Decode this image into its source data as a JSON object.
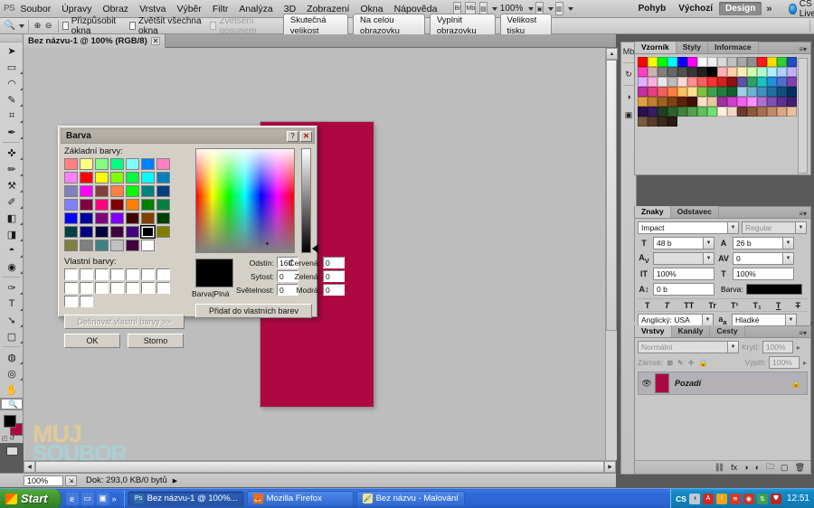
{
  "app": {
    "name": "Adobe Photoshop CS5",
    "logo": "PS"
  },
  "menubar": {
    "items": [
      "Soubor",
      "Úpravy",
      "Obraz",
      "Vrstva",
      "Výběr",
      "Filtr",
      "Analýza",
      "3D",
      "Zobrazení",
      "Okna",
      "Nápověda"
    ],
    "bridge_icon": "br-icon",
    "minibridge_icon": "mb-icon",
    "arrange_icon": "arrange-documents-icon",
    "zoom_level": "100%",
    "screen_mode_icon": "screen-mode-icon",
    "view_extras_icon": "view-extras-icon",
    "workspaces": [
      "Pohyb",
      "Výchozí",
      "Design"
    ],
    "active_workspace": "Design",
    "more_workspaces": "»",
    "cs_live": "CS Live",
    "window_buttons": [
      "minimize",
      "restore",
      "close"
    ]
  },
  "optionsbar": {
    "tool_icon": "zoom-tool-icon",
    "zoom_in_icon": "zoom-in-icon",
    "zoom_out_icon": "zoom-out-icon",
    "checkboxes": [
      {
        "label": "Přizpůsobit okna",
        "checked": false,
        "disabled": false
      },
      {
        "label": "Zvětšit všechna okna",
        "checked": false,
        "disabled": false
      },
      {
        "label": "Zvětšení posunem",
        "checked": false,
        "disabled": true
      }
    ],
    "buttons": [
      "Skutečná velikost",
      "Na celou obrazovku",
      "Vyplnit obrazovku",
      "Velikost tisku"
    ]
  },
  "toolbar": {
    "tools": [
      {
        "name": "move-tool",
        "glyph": "➤"
      },
      {
        "name": "marquee-tool",
        "glyph": "▭"
      },
      {
        "name": "lasso-tool",
        "glyph": "◠"
      },
      {
        "name": "quick-selection-tool",
        "glyph": "✎"
      },
      {
        "name": "crop-tool",
        "glyph": "⌗"
      },
      {
        "name": "eyedropper-tool",
        "glyph": "✒"
      },
      {
        "name": "spot-healing-brush-tool",
        "glyph": "✜"
      },
      {
        "name": "brush-tool",
        "glyph": "✏"
      },
      {
        "name": "clone-stamp-tool",
        "glyph": "⚑"
      },
      {
        "name": "history-brush-tool",
        "glyph": "✐"
      },
      {
        "name": "eraser-tool",
        "glyph": "◧"
      },
      {
        "name": "gradient-tool",
        "glyph": "◨"
      },
      {
        "name": "blur-tool",
        "glyph": "💧"
      },
      {
        "name": "dodge-tool",
        "glyph": "🔍"
      },
      {
        "name": "pen-tool",
        "glyph": "✑"
      },
      {
        "name": "type-tool",
        "glyph": "T"
      },
      {
        "name": "path-selection-tool",
        "glyph": "➘"
      },
      {
        "name": "rectangle-tool",
        "glyph": "▢"
      },
      {
        "name": "3d-rotate-tool",
        "glyph": "◍"
      },
      {
        "name": "3d-orbit-tool",
        "glyph": "◉"
      },
      {
        "name": "hand-tool",
        "glyph": "✋"
      },
      {
        "name": "zoom-tool",
        "glyph": "🔍",
        "selected": true
      }
    ],
    "foreground_color": "#000000",
    "background_color": "#ae0842",
    "quick_mask_icon": "quick-mask-icon"
  },
  "document": {
    "tab_title": "Bez názvu-1 @ 100% (RGB/8)",
    "close_icon": "close-icon",
    "canvas_color": "#ae0842"
  },
  "watermark": {
    "line1": "MUJ",
    "line2": "SOUBOR"
  },
  "statusbar": {
    "zoom": "100%",
    "zoom_btn_icon": "screen-resize-icon",
    "doc_info": "Dok: 293,0 KB/0 bytů",
    "play_icon": "play-icon"
  },
  "panels": {
    "swatches": {
      "tabs": [
        "Vzorník",
        "Styly",
        "Informace"
      ],
      "active_tab": "Vzorník",
      "menu_icon": "panel-menu-icon",
      "colors": [
        "#ff0000",
        "#ffff00",
        "#00ff00",
        "#00ffff",
        "#0000ff",
        "#ff00ff",
        "#ffffff",
        "#f0f0f0",
        "#d8d8d8",
        "#c0c0c0",
        "#a8a8a8",
        "#909090",
        "#ff1a1a",
        "#ffe000",
        "#30d030",
        "#2050c0",
        "#ff40c0",
        "#d0b0b0",
        "#808080",
        "#686868",
        "#505050",
        "#383838",
        "#202020",
        "#000000",
        "#ffb0b0",
        "#ffd0b0",
        "#fff0b0",
        "#d0ffb0",
        "#b0ffd0",
        "#b0f0ff",
        "#b0d0ff",
        "#c0b0ff",
        "#e0b0ff",
        "#ffb0e0",
        "#e8e8e8",
        "#bcbcbc",
        "#ffd8d8",
        "#ff9090",
        "#ff6060",
        "#ff3030",
        "#d02020",
        "#901010",
        "#6050a0",
        "#30a060",
        "#20c0c0",
        "#2090e0",
        "#5070d0",
        "#8040b0",
        "#c030a0",
        "#e04080",
        "#f06060",
        "#ff8040",
        "#ffc060",
        "#ffe090",
        "#80c040",
        "#40a050",
        "#208040",
        "#106030",
        "#a0d0e0",
        "#70b0d0",
        "#4090c0",
        "#2070a0",
        "#105080",
        "#003060",
        "#e0a040",
        "#c08030",
        "#a06020",
        "#804010",
        "#602008",
        "#401004",
        "#f8e0c0",
        "#e8c8a0",
        "#a030a0",
        "#d040d0",
        "#f060f0",
        "#ff90ff",
        "#b070d0",
        "#8050b0",
        "#603090",
        "#402070",
        "#2a1050",
        "#3a1a60",
        "#204020",
        "#306030",
        "#408040",
        "#50a050",
        "#60c060",
        "#70e070",
        "#fff0e0",
        "#f0d8c8",
        "#6a3b2a",
        "#8b5a3c",
        "#a87050",
        "#c08a68",
        "#d8a884",
        "#e8c0a0",
        "#7a5a3a",
        "#5a3a2a",
        "#3a2a1a",
        "#2a1a10"
      ]
    },
    "character": {
      "tabs": [
        "Znaky",
        "Odstavec"
      ],
      "active_tab": "Znaky",
      "menu_icon": "panel-menu-icon",
      "font_family": "Impact",
      "font_style": "Regular",
      "font_size": "48 b",
      "leading": "26 b",
      "kerning": "",
      "tracking": "0",
      "vertical_scale": "100%",
      "horizontal_scale": "100%",
      "baseline_shift": "0 b",
      "color_label": "Barva:",
      "color": "#000000",
      "style_buttons": [
        "T",
        "T",
        "TT",
        "Tr",
        "T¹",
        "T₁",
        "T",
        "T"
      ],
      "language": "Anglický: USA",
      "antialias": "Hladké",
      "antialias_icon": "antialias-icon"
    },
    "layers": {
      "tabs": [
        "Vrstvy",
        "Kanály",
        "Cesty"
      ],
      "active_tab": "Vrstvy",
      "menu_icon": "panel-menu-icon",
      "blend_mode": "Normální",
      "opacity_label": "Krytí:",
      "opacity_value": "100%",
      "lock_label": "Zámek:",
      "fill_label": "Výplň:",
      "fill_value": "100%",
      "lock_icons": [
        "lock-transparency-icon",
        "lock-image-icon",
        "lock-position-icon",
        "lock-all-icon"
      ],
      "items": [
        {
          "name": "Pozadí",
          "visible": true,
          "locked": true,
          "thumb_color": "#ae0842"
        }
      ],
      "footer_icons": [
        "link-layers-icon",
        "layer-style-icon",
        "layer-mask-icon",
        "adjustment-layer-icon",
        "new-group-icon",
        "new-layer-icon",
        "delete-layer-icon"
      ]
    },
    "dock_strip_icons": [
      "mini-bridge-icon",
      "history-icon",
      "adjustments-icon",
      "masks-icon"
    ]
  },
  "dialog": {
    "title": "Barva",
    "help_icon": "help-icon",
    "close_icon": "close-icon",
    "basic_colors_label": "Základní barvy:",
    "custom_colors_label": "Vlastní barvy:",
    "define_custom_button": "Definovat vlastní barvy >>",
    "ok_button": "OK",
    "cancel_button": "Storno",
    "add_custom_button": "Přidat do vlastních barev",
    "color_preview_label": "Barva|Plná",
    "fields": [
      {
        "label": "Odstín:",
        "value": "160"
      },
      {
        "label": "Sytost:",
        "value": "0"
      },
      {
        "label": "Světelnost:",
        "value": "0"
      },
      {
        "label": "Červená:",
        "value": "0"
      },
      {
        "label": "Zelená:",
        "value": "0"
      },
      {
        "label": "Modrá:",
        "value": "0"
      }
    ],
    "preview_color": "#000000",
    "basic_colors": [
      "#ff8080",
      "#ffff80",
      "#80ff80",
      "#00ff80",
      "#80ffff",
      "#0080ff",
      "#ff80c0",
      "#ff80ff",
      "#ff0000",
      "#ffff00",
      "#80ff00",
      "#00ff40",
      "#00ffff",
      "#0080c0",
      "#8080c0",
      "#ff00ff",
      "#804040",
      "#ff8040",
      "#00ff00",
      "#008080",
      "#004080",
      "#8080ff",
      "#800040",
      "#ff0080",
      "#800000",
      "#ff8000",
      "#008000",
      "#008040",
      "#0000ff",
      "#0000a0",
      "#800080",
      "#8000ff",
      "#400000",
      "#804000",
      "#004000",
      "#004040",
      "#000080",
      "#000040",
      "#400040",
      "#400080",
      "#000000",
      "#808000",
      "#808040",
      "#808080",
      "#408080",
      "#c0c0c0",
      "#400040",
      "#ffffff"
    ],
    "selected_basic_index": 40
  },
  "taskbar": {
    "start_label": "Start",
    "quicklaunch_icons": [
      "ie-icon",
      "show-desktop-icon",
      "media-player-icon"
    ],
    "quicklaunch_more": "»",
    "tasks": [
      {
        "label": "Bez názvu-1 @ 100%...",
        "icon": "photoshop-icon",
        "active": true
      },
      {
        "label": "Mozilla Firefox",
        "icon": "firefox-icon",
        "active": false
      },
      {
        "label": "Bez názvu - Malování",
        "icon": "paint-icon",
        "active": false
      }
    ],
    "tray_label": "CS",
    "tray_icons": [
      "cs-live-icon",
      "acrobat-icon",
      "security-icon",
      "ati-icon",
      "antivirus-icon",
      "network-icon",
      "shield-icon"
    ],
    "clock": "12:51"
  }
}
